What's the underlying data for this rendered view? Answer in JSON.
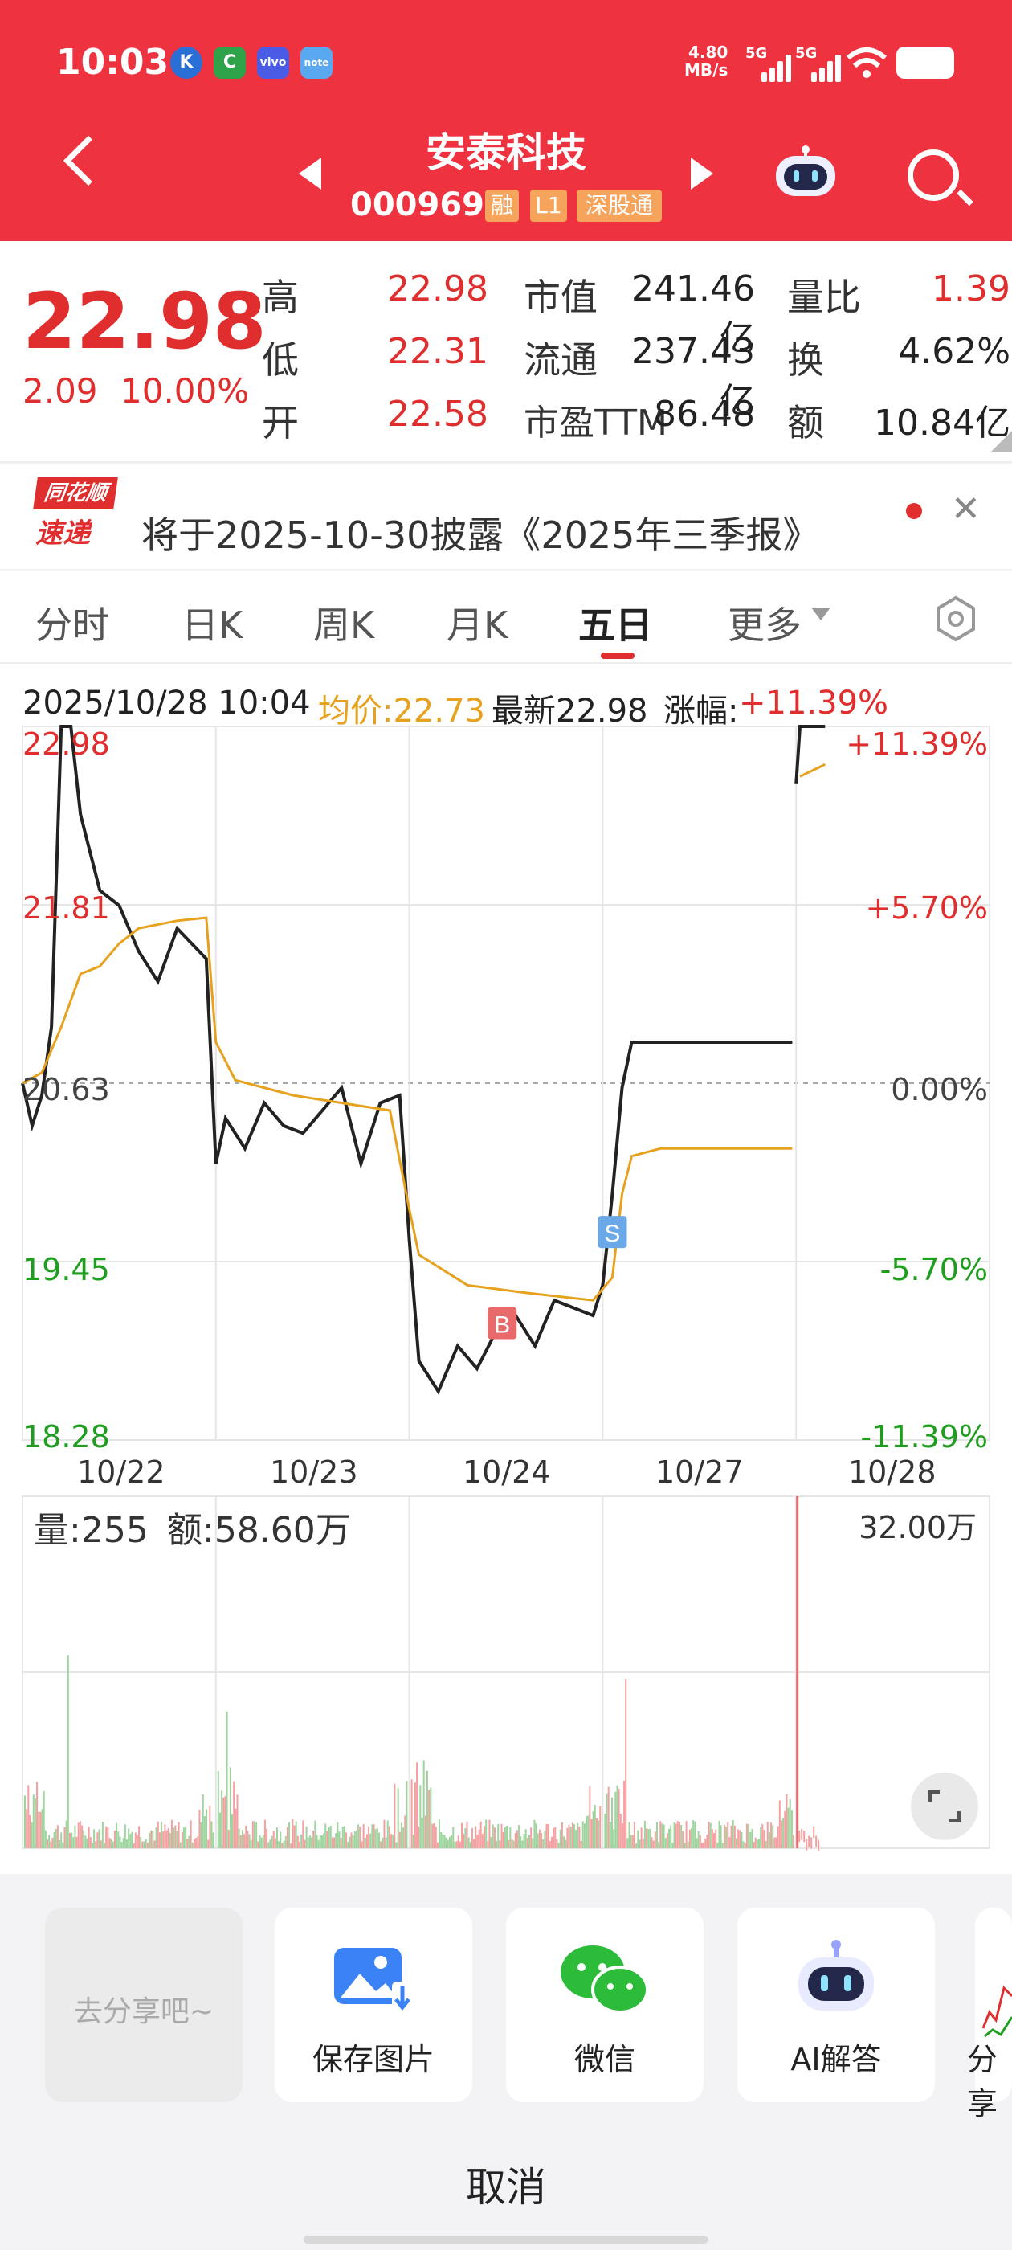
{
  "status_bar": {
    "time": "10:03",
    "net_speed_value": "4.80",
    "net_speed_unit": "MB/s",
    "signal1": "5G",
    "signal2": "5G",
    "app_icons": [
      "K",
      "C",
      "vivo",
      "note"
    ]
  },
  "header": {
    "stock_name": "安泰科技",
    "stock_code": "000969",
    "tags": [
      "融",
      "L1",
      "深股通"
    ]
  },
  "quote": {
    "price": "22.98",
    "change": "2.09",
    "change_pct": "10.00%",
    "rows": [
      {
        "k1": "高",
        "v1": "22.98",
        "k2": "市值",
        "v2": "241.46亿",
        "k3": "量比",
        "v3": "1.39"
      },
      {
        "k1": "低",
        "v1": "22.31",
        "k2": "流通",
        "v2": "237.43亿",
        "k3": "换",
        "v3": "4.62%"
      },
      {
        "k1": "开",
        "v1": "22.58",
        "k2": "市盈TTM",
        "v2": "86.48",
        "k3": "额",
        "v3": "10.84亿"
      }
    ]
  },
  "notice": {
    "logo_top": "同花顺",
    "logo_bottom": "速递",
    "text": "将于2025-10-30披露《2025年三季报》"
  },
  "tabs": {
    "items": [
      "分时",
      "日K",
      "周K",
      "月K",
      "五日",
      "更多"
    ],
    "active": "五日"
  },
  "chart_info": {
    "datetime": "2025/10/28 10:04",
    "avg_label": "均价:22.73",
    "latest_label": "最新22.98",
    "change_label": "涨幅:",
    "change_value": "+11.39%"
  },
  "chart_data": {
    "type": "line",
    "title": "",
    "xlabel": "",
    "ylabel": "",
    "ylim": [
      18.28,
      22.98
    ],
    "prev_close": 20.63,
    "y_ticks_left": [
      "22.98",
      "21.81",
      "20.63",
      "19.45",
      "18.28"
    ],
    "y_ticks_right": [
      "+11.39%",
      "+5.70%",
      "0.00%",
      "-5.70%",
      "-11.39%"
    ],
    "x_ticks": [
      "10/22",
      "10/23",
      "10/24",
      "10/27",
      "10/28"
    ],
    "markers": [
      {
        "label": "B",
        "day": "10/24"
      },
      {
        "label": "S",
        "day": "10/27"
      }
    ],
    "series": [
      {
        "name": "",
        "color": "#222222",
        "x": [
          0,
          0.05,
          0.1,
          0.15,
          0.2,
          0.25,
          0.3,
          0.4,
          0.5,
          0.6,
          0.7,
          0.8,
          0.95,
          1.0,
          1.05,
          1.15,
          1.25,
          1.35,
          1.45,
          1.55,
          1.65,
          1.75,
          1.85,
          1.95,
          2.0,
          2.05,
          2.15,
          2.25,
          2.35,
          2.45,
          2.55,
          2.65,
          2.75,
          2.85,
          2.95,
          3.0,
          3.05,
          3.1,
          3.15,
          3.2,
          3.3,
          3.5,
          3.75,
          3.98,
          4.0,
          4.02,
          4.15
        ],
        "values": [
          20.63,
          20.35,
          20.55,
          21.0,
          22.98,
          22.98,
          22.4,
          21.9,
          21.8,
          21.5,
          21.3,
          21.65,
          21.45,
          20.1,
          20.4,
          20.2,
          20.5,
          20.35,
          20.3,
          20.45,
          20.6,
          20.1,
          20.5,
          20.55,
          19.6,
          18.8,
          18.6,
          18.9,
          18.75,
          19.0,
          19.1,
          18.9,
          19.2,
          19.15,
          19.1,
          19.3,
          19.9,
          20.6,
          20.9,
          20.9,
          20.9,
          20.9,
          20.9,
          20.9,
          22.6,
          22.98,
          22.98
        ]
      },
      {
        "name": "均价",
        "color": "#e6a21e",
        "x": [
          0,
          0.1,
          0.2,
          0.3,
          0.4,
          0.5,
          0.6,
          0.8,
          0.95,
          1.0,
          1.1,
          1.4,
          1.9,
          2.0,
          2.05,
          2.3,
          2.6,
          2.95,
          3.05,
          3.1,
          3.15,
          3.3,
          3.6,
          3.98,
          4.02,
          4.15
        ],
        "values": [
          20.63,
          20.7,
          21.0,
          21.35,
          21.4,
          21.55,
          21.65,
          21.7,
          21.72,
          20.9,
          20.65,
          20.55,
          20.45,
          19.8,
          19.5,
          19.3,
          19.25,
          19.2,
          19.35,
          19.9,
          20.15,
          20.2,
          20.2,
          20.2,
          22.65,
          22.73
        ]
      }
    ],
    "volume": {
      "label": "量",
      "value": "255",
      "amount_label": "额",
      "amount_value": "58.60万",
      "max_label": "32.00万"
    }
  },
  "share_sheet": {
    "placeholder_label": "去分享吧~",
    "items": [
      {
        "label": "保存图片",
        "icon": "save-image-icon"
      },
      {
        "label": "微信",
        "icon": "wechat-icon"
      },
      {
        "label": "AI解答",
        "icon": "ai-robot-icon"
      },
      {
        "label": "分享",
        "icon": "share-icon"
      }
    ],
    "cancel": "取消"
  },
  "colors": {
    "brand_red": "#ef3240",
    "price_red": "#e02e2e",
    "down_green": "#1f9d1f",
    "avg_yellow": "#e6a21e"
  }
}
